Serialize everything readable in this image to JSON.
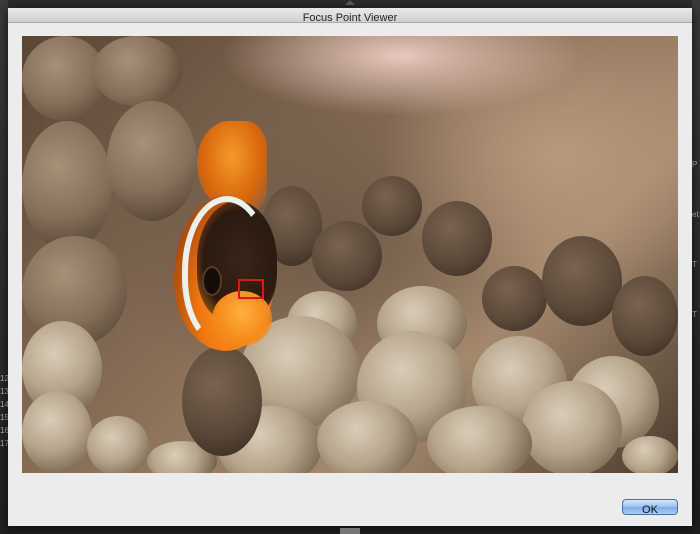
{
  "window": {
    "title": "Focus Point Viewer"
  },
  "dialog": {
    "ok_label": "OK"
  },
  "background_app": {
    "left_numbers": [
      "12",
      "13",
      "14",
      "15",
      "16",
      "17"
    ],
    "right_letters": [
      "P",
      "et",
      "T",
      "T"
    ]
  },
  "colors": {
    "focus_point": "#e01414",
    "ok_button": "#9cc1f0",
    "dialog_background": "#ececec"
  }
}
